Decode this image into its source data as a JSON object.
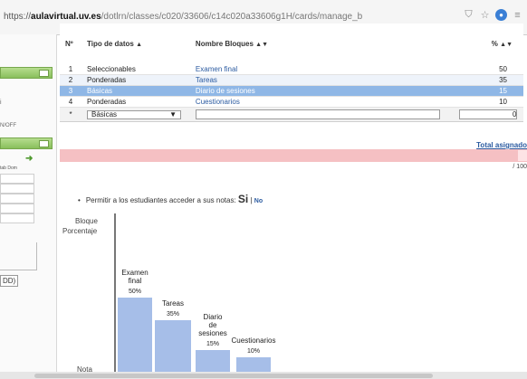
{
  "browser": {
    "url_scheme": "https://",
    "url_domain": "aulavirtual.uv.es",
    "url_path": "/dotlrn/classes/c020/33606/c14c020a33606g1H/cards/manage_b"
  },
  "sidebar": {
    "onoff": "N/OFF",
    "i_letter": "i",
    "tabs_header": "tab Dom",
    "add_label": "DD)"
  },
  "table": {
    "headers": {
      "n": "Nº",
      "tipo": "Tipo de datos",
      "nombre": "Nombre Bloques",
      "pct": "%"
    },
    "rows": [
      {
        "n": "1",
        "tipo": "Seleccionables",
        "nombre": "Examen final",
        "pct": "50"
      },
      {
        "n": "2",
        "tipo": "Ponderadas",
        "nombre": "Tareas",
        "pct": "35"
      },
      {
        "n": "3",
        "tipo": "Básicas",
        "nombre": "Diario de sesiones",
        "pct": "15"
      },
      {
        "n": "4",
        "tipo": "Ponderadas",
        "nombre": "Cuestionarios",
        "pct": "10"
      }
    ],
    "new_row": {
      "marker": "*",
      "tipo_selected": "Básicas",
      "pct_value": "0"
    }
  },
  "total": {
    "label": "Total asignado",
    "denominator": "/ 100"
  },
  "permit": {
    "text": "Permitir a los estudiantes acceder a sus notas:",
    "si": "Si",
    "separator": "|",
    "no": "No"
  },
  "chart_data": {
    "type": "bar",
    "categories": [
      "Examen final",
      "Tareas",
      "Diario de sesiones",
      "Cuestionarios"
    ],
    "category_lines": [
      [
        "Examen",
        "final"
      ],
      [
        "Tareas"
      ],
      [
        "Diario",
        "de",
        "sesiones"
      ],
      [
        "Cuestionarios"
      ]
    ],
    "values": [
      50,
      35,
      15,
      10
    ],
    "value_labels": [
      "50%",
      "35%",
      "15%",
      "10%"
    ],
    "row_labels": [
      "Bloque",
      "Porcentaje",
      "Nota"
    ],
    "ylim": [
      0,
      100
    ],
    "bar_color": "#a6bee8",
    "grid": false
  },
  "colors": {
    "selected_row": "#8fb7e6",
    "alt_row": "#eef3fa",
    "link": "#2a5aa0",
    "total_band": "#f5c0c3"
  }
}
